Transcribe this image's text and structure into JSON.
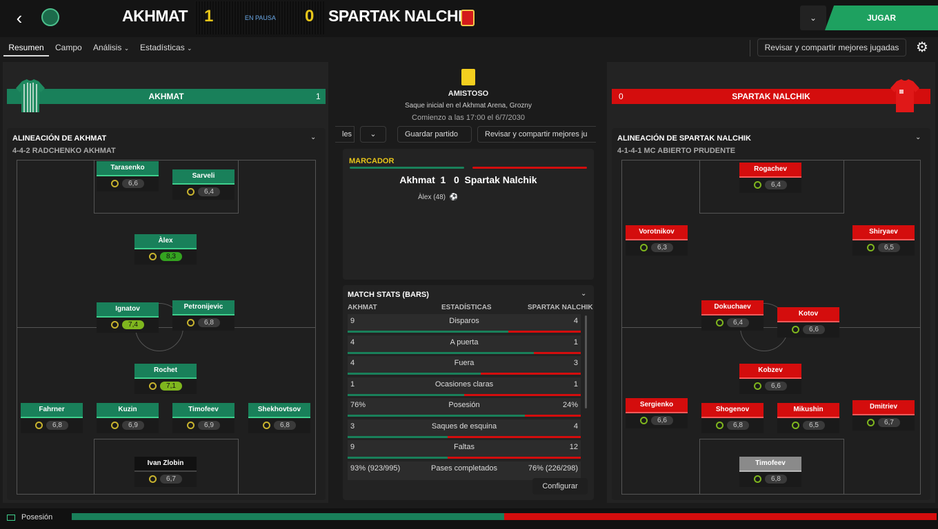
{
  "header": {
    "home_team": "AKHMAT",
    "away_team": "SPARTAK NALCHIK",
    "home_score": "1",
    "away_score": "0",
    "status": "EN PAUSA",
    "play_button": "JUGAR"
  },
  "nav": {
    "tabs": [
      "Resumen",
      "Campo",
      "Análisis",
      "Estadísticas"
    ],
    "review_button": "Revisar y compartir mejores jugadas"
  },
  "home": {
    "bar_name": "AKHMAT",
    "bar_score": "1",
    "lineup_title": "ALINEACIÓN DE AKHMAT",
    "formation": "4-4-2 RADCHENKO AKHMAT",
    "players": [
      {
        "name": "Tarasenko",
        "rating": "6,6"
      },
      {
        "name": "Sarveli",
        "rating": "6,4"
      },
      {
        "name": "Àlex",
        "rating": "8,3"
      },
      {
        "name": "Ignatov",
        "rating": "7,4"
      },
      {
        "name": "Petronijevic",
        "rating": "6,8"
      },
      {
        "name": "Rochet",
        "rating": "7,1"
      },
      {
        "name": "Fahrner",
        "rating": "6,8"
      },
      {
        "name": "Kuzin",
        "rating": "6,9"
      },
      {
        "name": "Timofeev",
        "rating": "6,9"
      },
      {
        "name": "Shekhovtsov",
        "rating": "6,8"
      },
      {
        "name": "Ivan Zlobin",
        "rating": "6,7"
      }
    ]
  },
  "away": {
    "bar_name": "SPARTAK NALCHIK",
    "bar_score": "0",
    "lineup_title": "ALINEACIÓN DE SPARTAK NALCHIK",
    "formation": "4-1-4-1 MC ABIERTO PRUDENTE",
    "players": [
      {
        "name": "Rogachev",
        "rating": "6,4"
      },
      {
        "name": "Vorotnikov",
        "rating": "6,3"
      },
      {
        "name": "Shiryaev",
        "rating": "6,5"
      },
      {
        "name": "Dokuchaev",
        "rating": "6,4"
      },
      {
        "name": "Kotov",
        "rating": "6,6"
      },
      {
        "name": "Kobzev",
        "rating": "6,6"
      },
      {
        "name": "Sergienko",
        "rating": "6,6"
      },
      {
        "name": "Shogenov",
        "rating": "6,8"
      },
      {
        "name": "Mikushin",
        "rating": "6,5"
      },
      {
        "name": "Dmitriev",
        "rating": "6,7"
      },
      {
        "name": "Timofeev",
        "rating": "6,8"
      }
    ]
  },
  "match": {
    "competition": "AMISTOSO",
    "kickoff": "Saque inicial en el Akhmat Arena, Grozny",
    "start": "Comienzo a las 17:00 el 6/7/2030",
    "btn_les": "les",
    "btn_save": "Guardar partido",
    "btn_review": "Revisar y compartir mejores ju",
    "marcador_title": "MARCADOR",
    "score_line": "Akhmat  1   0  Spartak Nalchik",
    "scorer": "Àlex (48)"
  },
  "stats": {
    "title": "MATCH STATS (BARS)",
    "head_home": "AKHMAT",
    "head_mid": "ESTADÍSTICAS",
    "head_away": "SPARTAK NALCHIK",
    "rows": [
      {
        "label": "Disparos",
        "home": "9",
        "away": "4",
        "home_frac": 0.69
      },
      {
        "label": "A puerta",
        "home": "4",
        "away": "1",
        "home_frac": 0.8
      },
      {
        "label": "Fuera",
        "home": "4",
        "away": "3",
        "home_frac": 0.57
      },
      {
        "label": "Ocasiones claras",
        "home": "1",
        "away": "1",
        "home_frac": 0.5
      },
      {
        "label": "Posesión",
        "home": "76%",
        "away": "24%",
        "home_frac": 0.76
      },
      {
        "label": "Saques de esquina",
        "home": "3",
        "away": "4",
        "home_frac": 0.43
      },
      {
        "label": "Faltas",
        "home": "9",
        "away": "12",
        "home_frac": 0.43
      },
      {
        "label": "Pases completados",
        "home": "93% (923/995)",
        "away": "76% (226/298)",
        "home_frac": null
      }
    ],
    "config_button": "Configurar"
  },
  "footer": {
    "label": "Posesión",
    "home_frac": 0.5
  },
  "colors": {
    "home": "#19805a",
    "away": "#d40d0d",
    "accent": "#1ea160"
  }
}
